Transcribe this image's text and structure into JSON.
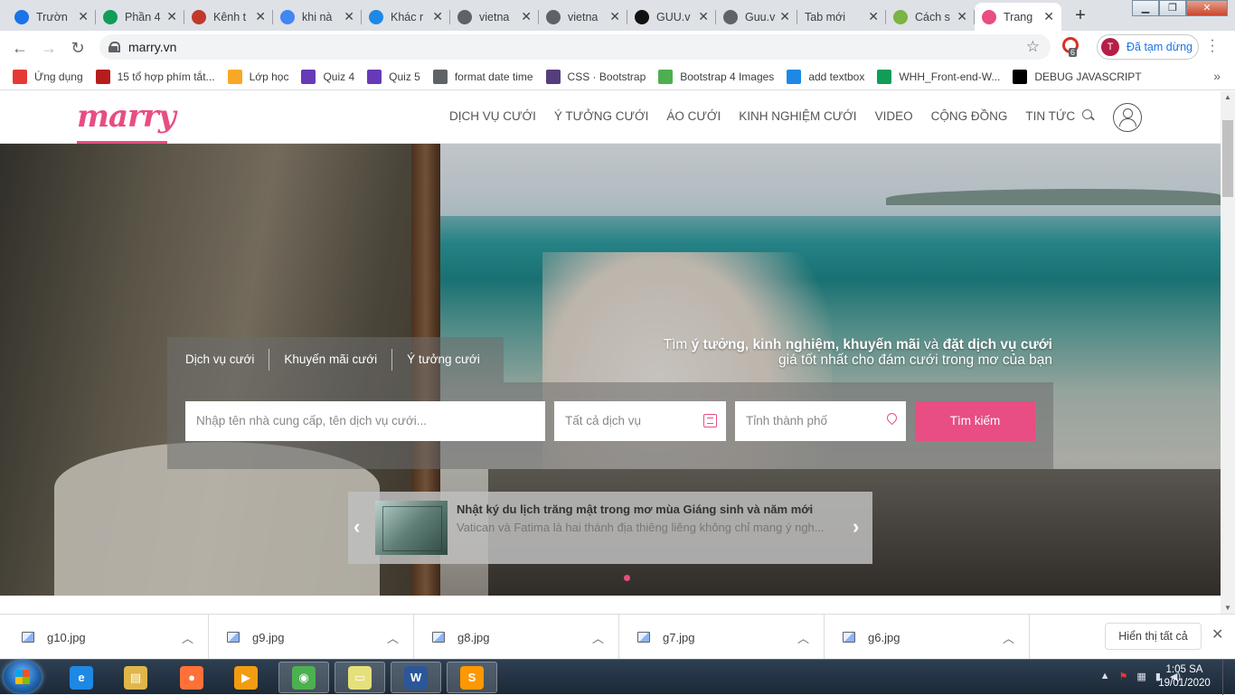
{
  "browser": {
    "tabs": [
      {
        "title": "Trườn",
        "icon": "info-icon",
        "color": "#1a73e8"
      },
      {
        "title": "Phần 4",
        "icon": "drive-icon",
        "color": "#0f9d58"
      },
      {
        "title": "Kênh t",
        "icon": "kenh14-icon",
        "color": "#c0392b"
      },
      {
        "title": "khi nà",
        "icon": "google-icon",
        "color": "#4285f4"
      },
      {
        "title": "Khác r",
        "icon": "c-icon",
        "color": "#1e88e5"
      },
      {
        "title": "vietna",
        "icon": "globe-icon",
        "color": "#5f6368"
      },
      {
        "title": "vietna",
        "icon": "globe-icon",
        "color": "#5f6368"
      },
      {
        "title": "GUU.v",
        "icon": "guu-icon",
        "color": "#111111"
      },
      {
        "title": "Guu.v",
        "icon": "globe-icon",
        "color": "#5f6368"
      },
      {
        "title": "Tab mới",
        "icon": "",
        "color": ""
      },
      {
        "title": "Cách s",
        "icon": "w-icon",
        "color": "#7cb342"
      },
      {
        "title": "Trang",
        "icon": "marry-icon",
        "color": "#e84d83",
        "active": true
      }
    ],
    "url": "marry.vn",
    "profile_initial": "T",
    "profile_status": "Đã tạm dừng",
    "ext_badge": "6",
    "bookmarks": [
      {
        "label": "Ứng dụng",
        "icon": "apps-grid-icon",
        "color": "#e53935"
      },
      {
        "label": "15 tổ hợp phím tắt...",
        "icon": "download-icon",
        "color": "#b71c1c"
      },
      {
        "label": "Lớp học",
        "icon": "classroom-icon",
        "color": "#f9a825"
      },
      {
        "label": "Quiz 4",
        "icon": "forms-icon",
        "color": "#673ab7"
      },
      {
        "label": "Quiz 5",
        "icon": "forms-icon",
        "color": "#673ab7"
      },
      {
        "label": "format date time",
        "icon": "globe-icon",
        "color": "#5f6368"
      },
      {
        "label": "CSS · Bootstrap",
        "icon": "bootstrap-icon",
        "color": "#563d7c"
      },
      {
        "label": "Bootstrap 4 Images",
        "icon": "w3-icon",
        "color": "#4caf50"
      },
      {
        "label": "add textbox",
        "icon": "cloud-icon",
        "color": "#1e88e5"
      },
      {
        "label": "WHH_Front-end-W...",
        "icon": "drive-icon",
        "color": "#0f9d58"
      },
      {
        "label": "DEBUG JAVASCRIPT",
        "icon": "medium-icon",
        "color": "#000000"
      }
    ]
  },
  "site": {
    "logo": "marry",
    "nav": [
      "DỊCH VỤ CƯỚI",
      "Ý TƯỞNG CƯỚI",
      "ÁO CƯỚI",
      "KINH NGHIỆM CƯỚI",
      "VIDEO",
      "CỘNG ĐỒNG",
      "TIN TỨC"
    ],
    "slogan": {
      "prefix": "Tìm ",
      "b1": "ý tưởng, kinh nghiệm, khuyến mãi",
      "mid": " và ",
      "b2": "đặt dịch vụ cưới",
      "line2": "giá tốt nhất cho đám cưới trong mơ của bạn"
    },
    "search_tabs": [
      "Dịch vụ cưới",
      "Khuyến mãi cưới",
      "Ý tưởng cưới"
    ],
    "search": {
      "keyword_placeholder": "Nhập tên nhà cung cấp, tên dịch vụ cưới...",
      "service_value": "Tất cả dịch vụ",
      "city_placeholder": "Tỉnh thành phố",
      "button": "Tìm kiếm"
    },
    "news": {
      "title": "Nhật ký du lịch trăng mật trong mơ mùa Giáng sinh và năm mới",
      "desc": "Vatican và Fatima là hai thánh địa thiêng liêng không chỉ mang ý ngh..."
    },
    "accent": "#e84d83"
  },
  "downloads": {
    "files": [
      "g10.jpg",
      "g9.jpg",
      "g8.jpg",
      "g7.jpg",
      "g6.jpg"
    ],
    "show_all": "Hiển thị tất cả"
  },
  "taskbar": {
    "time": "1:05 SA",
    "date": "19/01/2020",
    "apps": [
      {
        "name": "ie-icon",
        "glyph": "e",
        "color": "#1e88e5"
      },
      {
        "name": "explorer-icon",
        "glyph": "▤",
        "color": "#e0b64a"
      },
      {
        "name": "firefox-icon",
        "glyph": "●",
        "color": "#ff7139"
      },
      {
        "name": "media-player-icon",
        "glyph": "▶",
        "color": "#f39c12"
      },
      {
        "name": "chrome-icon",
        "glyph": "◉",
        "color": "#4caf50"
      },
      {
        "name": "sticky-notes-icon",
        "glyph": "▭",
        "color": "#e6e07a"
      },
      {
        "name": "word-icon",
        "glyph": "W",
        "color": "#2b579a"
      },
      {
        "name": "sublime-icon",
        "glyph": "S",
        "color": "#ff9800"
      }
    ]
  }
}
